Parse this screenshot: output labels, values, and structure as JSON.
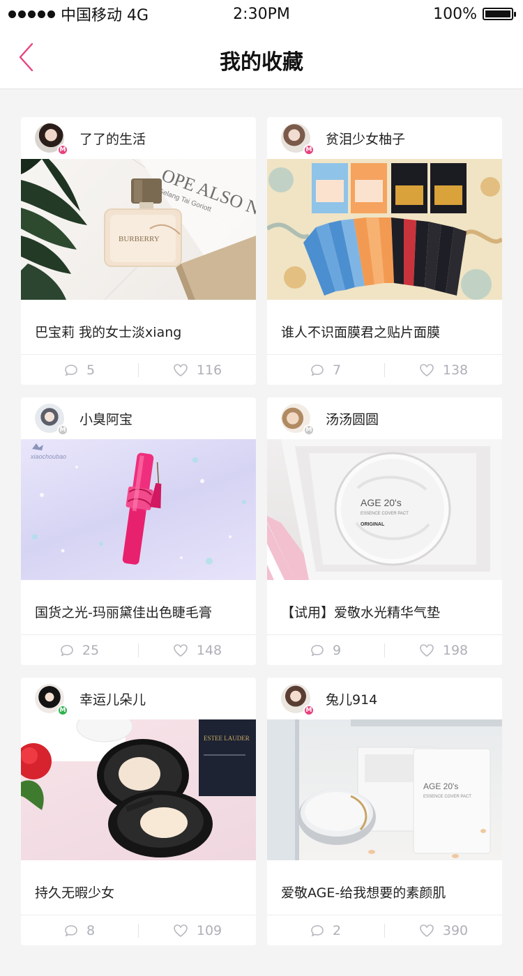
{
  "status_bar": {
    "carrier": "中国移动 4G",
    "time": "2:30PM",
    "battery": "100%"
  },
  "nav": {
    "title": "我的收藏",
    "back_icon": "chevron-left-icon",
    "accent_color": "#e7427e"
  },
  "cards": [
    {
      "username": "了了的生活",
      "badge": "M",
      "badge_color": "#e7427e",
      "title": "巴宝莉 我的女士淡xiang",
      "comments": "5",
      "likes": "116",
      "image_text_1": "OPE ALSO N",
      "image_text_2": "Gelang Tai Goriott",
      "image_text_3": "BURBERRY"
    },
    {
      "username": "贫泪少女柚子",
      "badge": "M",
      "badge_color": "#e7427e",
      "title": "谁人不识面膜君之贴片面膜",
      "comments": "7",
      "likes": "138"
    },
    {
      "username": "小臭阿宝",
      "badge": "M",
      "badge_color": "#c7c7c7",
      "title": "国货之光-玛丽黛佳出色睫毛膏",
      "comments": "25",
      "likes": "148",
      "image_text_1": "xiaochoubao"
    },
    {
      "username": "汤汤圆圆",
      "badge": "M",
      "badge_color": "#c7c7c7",
      "title": "【试用】爱敬水光精华气垫",
      "comments": "9",
      "likes": "198",
      "image_text_1": "AGE 20's",
      "image_text_2": "ESSENCE COVER PACT",
      "image_text_3": "ORIGINAL"
    },
    {
      "username": "幸运儿朵儿",
      "badge": "M",
      "badge_color": "#2fb24f",
      "title": "持久无暇少女",
      "comments": "8",
      "likes": "109",
      "image_text_1": "ESTEE LAUDER"
    },
    {
      "username": "兔儿914",
      "badge": "M",
      "badge_color": "#e7427e",
      "title": "爱敬AGE-给我想要的素颜肌",
      "comments": "2",
      "likes": "390",
      "image_text_1": "AGE 20's",
      "image_text_2": "ESSENCE COVER PACT"
    }
  ]
}
